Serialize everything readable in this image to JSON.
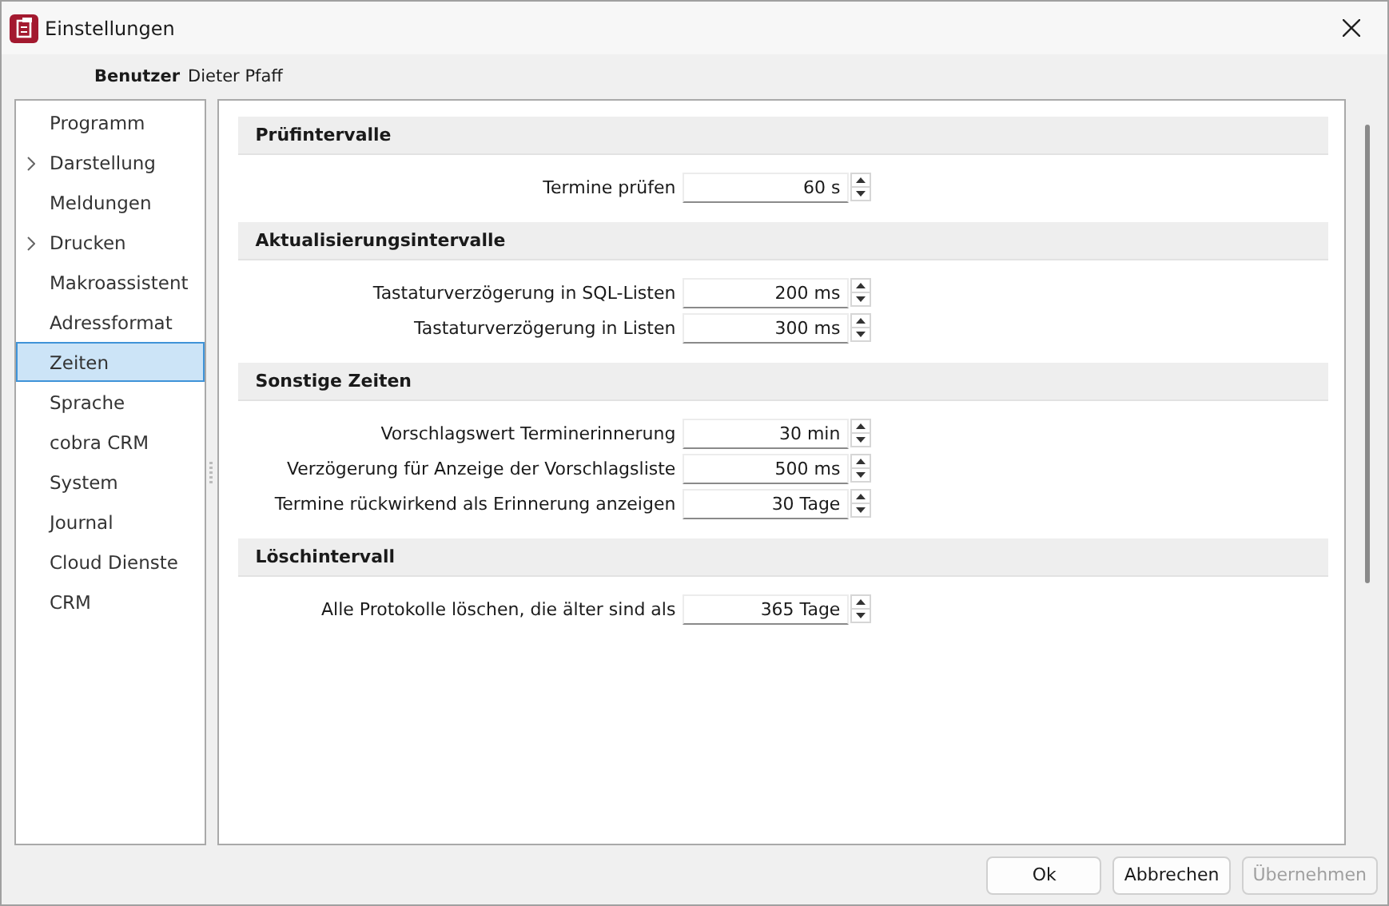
{
  "window": {
    "title": "Einstellungen"
  },
  "user": {
    "label": "Benutzer",
    "name": "Dieter Pfaff"
  },
  "sidebar": {
    "items": [
      {
        "label": "Programm",
        "expandable": false,
        "selected": false
      },
      {
        "label": "Darstellung",
        "expandable": true,
        "selected": false
      },
      {
        "label": "Meldungen",
        "expandable": false,
        "selected": false
      },
      {
        "label": "Drucken",
        "expandable": true,
        "selected": false
      },
      {
        "label": "Makroassistent",
        "expandable": false,
        "selected": false
      },
      {
        "label": "Adressformat",
        "expandable": false,
        "selected": false
      },
      {
        "label": "Zeiten",
        "expandable": false,
        "selected": true
      },
      {
        "label": "Sprache",
        "expandable": false,
        "selected": false
      },
      {
        "label": "cobra CRM",
        "expandable": false,
        "selected": false
      },
      {
        "label": "System",
        "expandable": false,
        "selected": false
      },
      {
        "label": "Journal",
        "expandable": false,
        "selected": false
      },
      {
        "label": "Cloud Dienste",
        "expandable": false,
        "selected": false
      },
      {
        "label": "CRM",
        "expandable": false,
        "selected": false
      }
    ]
  },
  "sections": [
    {
      "title": "Prüfintervalle",
      "fields": [
        {
          "label": "Termine prüfen",
          "value": "60 s"
        }
      ]
    },
    {
      "title": "Aktualisierungsintervalle",
      "fields": [
        {
          "label": "Tastaturverzögerung in SQL-Listen",
          "value": "200 ms"
        },
        {
          "label": "Tastaturverzögerung in Listen",
          "value": "300 ms"
        }
      ]
    },
    {
      "title": "Sonstige Zeiten",
      "fields": [
        {
          "label": "Vorschlagswert Terminerinnerung",
          "value": "30 min"
        },
        {
          "label": "Verzögerung für Anzeige der Vorschlagsliste",
          "value": "500 ms"
        },
        {
          "label": "Termine rückwirkend als Erinnerung anzeigen",
          "value": "30 Tage"
        }
      ]
    },
    {
      "title": "Löschintervall",
      "fields": [
        {
          "label": "Alle Protokolle löschen, die älter sind als",
          "value": "365 Tage"
        }
      ]
    }
  ],
  "buttons": [
    {
      "label": "Ok",
      "disabled": false
    },
    {
      "label": "Abbrechen",
      "disabled": false
    },
    {
      "label": "Übernehmen",
      "disabled": true
    }
  ]
}
